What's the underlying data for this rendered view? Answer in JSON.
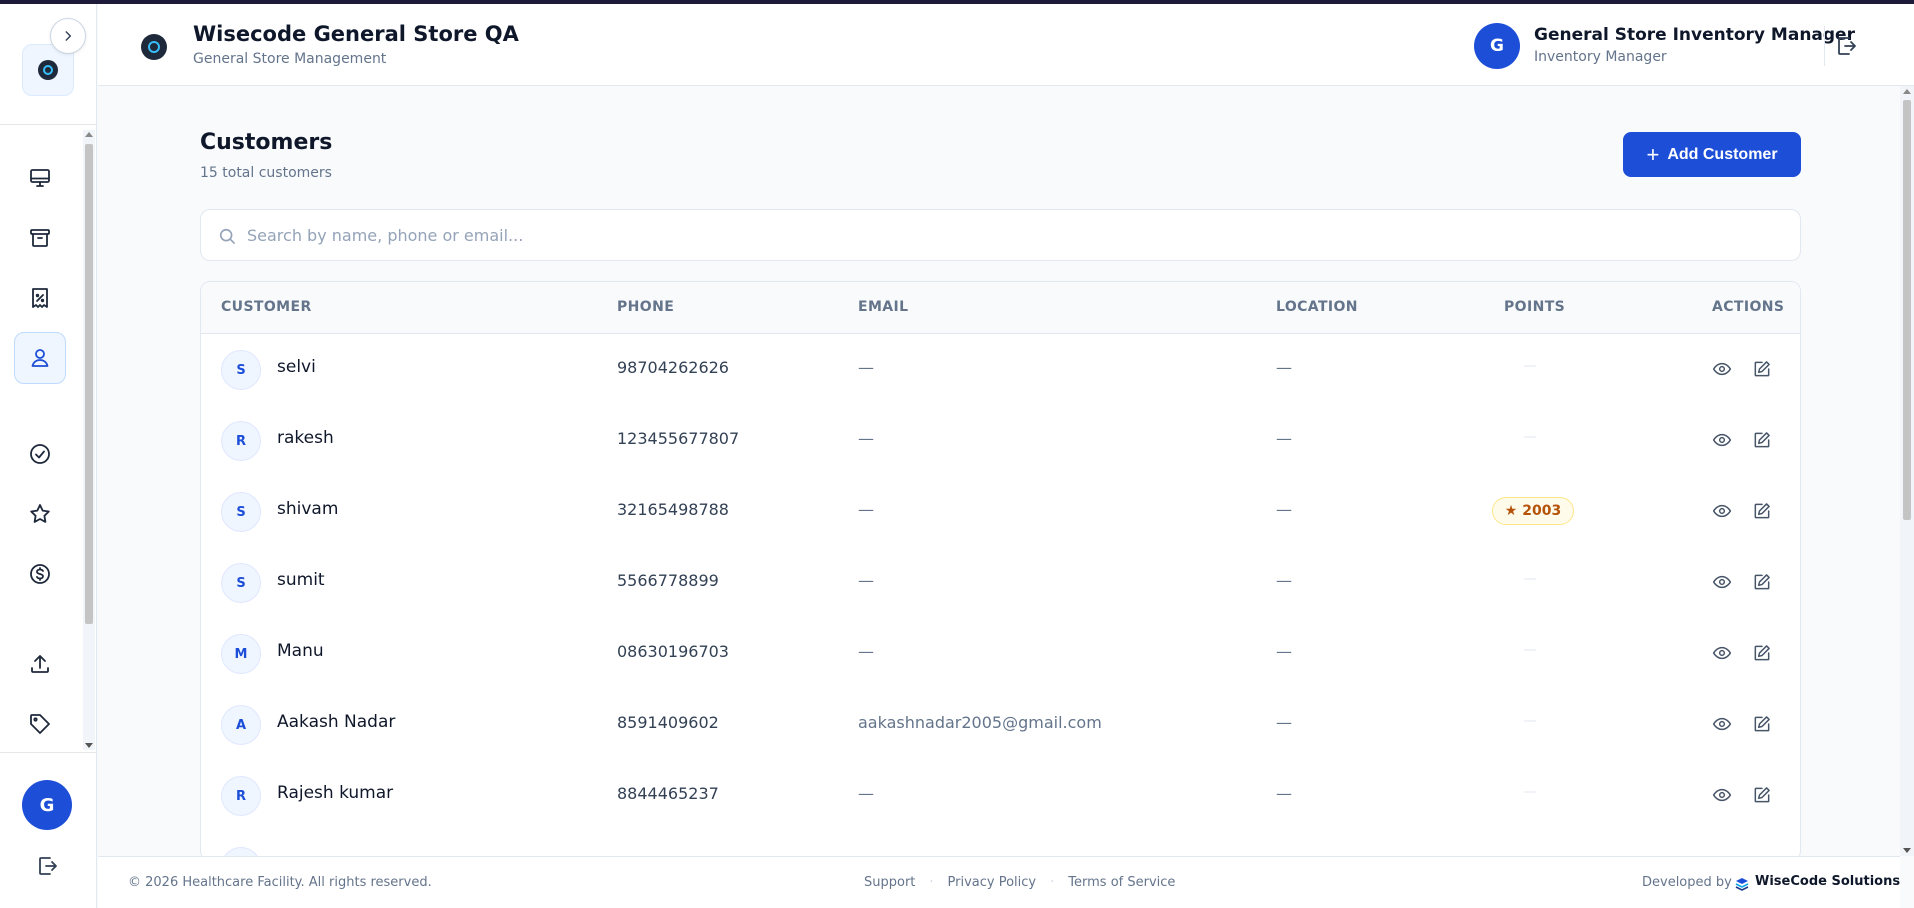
{
  "app": {
    "title": "Wisecode General Store QA",
    "subtitle": "General Store Management"
  },
  "user": {
    "initial": "G",
    "name": "General Store Inventory Manager",
    "role": "Inventory Manager"
  },
  "sidebar": {
    "items": [
      {
        "name": "dashboard",
        "icon": "monitor-icon"
      },
      {
        "name": "inventory",
        "icon": "archive-box-icon"
      },
      {
        "name": "billing",
        "icon": "receipt-percent-icon"
      },
      {
        "name": "customers",
        "icon": "user-icon",
        "active": true
      },
      {
        "name": "approvals",
        "icon": "check-circle-icon"
      },
      {
        "name": "loyalty",
        "icon": "star-icon"
      },
      {
        "name": "payments",
        "icon": "dollar-circle-icon"
      },
      {
        "name": "upload",
        "icon": "upload-icon"
      },
      {
        "name": "tags",
        "icon": "tag-icon"
      }
    ],
    "avatar_initial": "G"
  },
  "page": {
    "title": "Customers",
    "count_text": "15 total customers",
    "add_button_label": "Add Customer",
    "search_placeholder": "Search by name, phone or email...",
    "search_value": ""
  },
  "table": {
    "columns": [
      "CUSTOMER",
      "PHONE",
      "EMAIL",
      "LOCATION",
      "POINTS",
      "ACTIONS"
    ],
    "rows": [
      {
        "initial": "S",
        "name": "selvi",
        "phone": "98704262626",
        "email": "—",
        "location": "—",
        "points": "—"
      },
      {
        "initial": "R",
        "name": "rakesh",
        "phone": "123455677807",
        "email": "—",
        "location": "—",
        "points": "—"
      },
      {
        "initial": "S",
        "name": "shivam",
        "phone": "32165498788",
        "email": "—",
        "location": "—",
        "points": "2003"
      },
      {
        "initial": "S",
        "name": "sumit",
        "phone": "5566778899",
        "email": "—",
        "location": "—",
        "points": "—"
      },
      {
        "initial": "M",
        "name": "Manu",
        "phone": "08630196703",
        "email": "—",
        "location": "—",
        "points": "—"
      },
      {
        "initial": "A",
        "name": "Aakash Nadar",
        "phone": "8591409602",
        "email": "aakashnadar2005@gmail.com",
        "location": "—",
        "points": "—"
      },
      {
        "initial": "R",
        "name": "Rajesh kumar",
        "phone": "8844465237",
        "email": "—",
        "location": "—",
        "points": "—"
      }
    ]
  },
  "footer": {
    "copyright": "© 2026 Healthcare Facility. All rights reserved.",
    "links": [
      "Support",
      "Privacy Policy",
      "Terms of Service"
    ],
    "developed_by_label": "Developed by",
    "developer_name": "WiseCode Solutions"
  },
  "colors": {
    "primary": "#1d4ed8",
    "badge_bg": "#fffbeb",
    "badge_text": "#b45309"
  }
}
